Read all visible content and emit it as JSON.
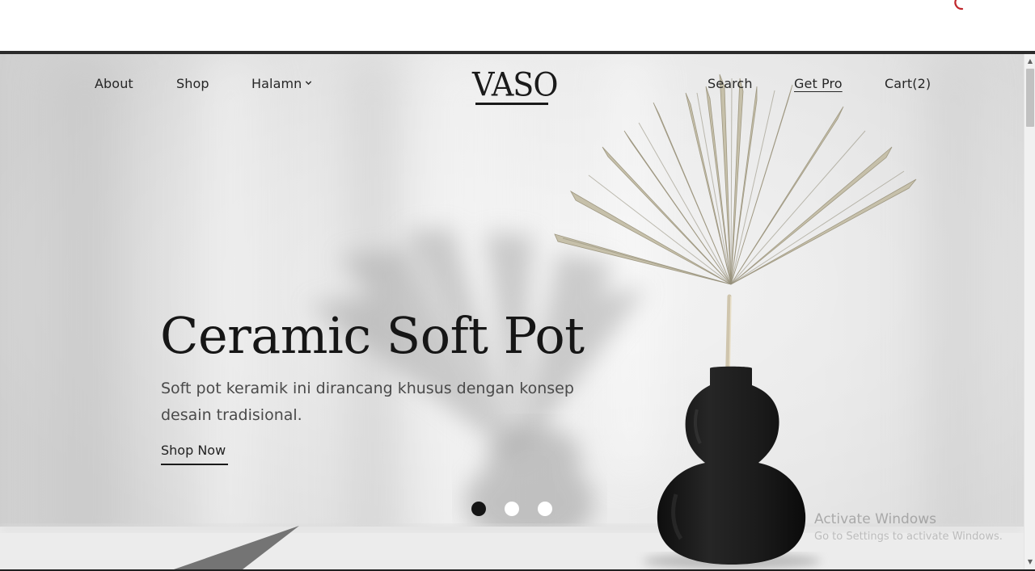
{
  "nav": {
    "about": "About",
    "shop": "Shop",
    "halamn": "Halamn",
    "search": "Search",
    "get_pro": "Get Pro",
    "cart": "Cart(2)"
  },
  "logo": "VASO",
  "hero": {
    "title": "Ceramic Soft Pot",
    "description": "Soft pot keramik ini dirancang khusus dengan konsep desain tradisional.",
    "cta": "Shop Now"
  },
  "slider": {
    "total_slides": 3,
    "active_slide": 1
  },
  "watermark": {
    "title": "Activate Windows",
    "subtitle": "Go to Settings to activate Windows."
  },
  "colors": {
    "text_dark": "#161616",
    "wall": "#e6e6e6",
    "vase": "#171717",
    "leaf": "#c9c3ad"
  }
}
